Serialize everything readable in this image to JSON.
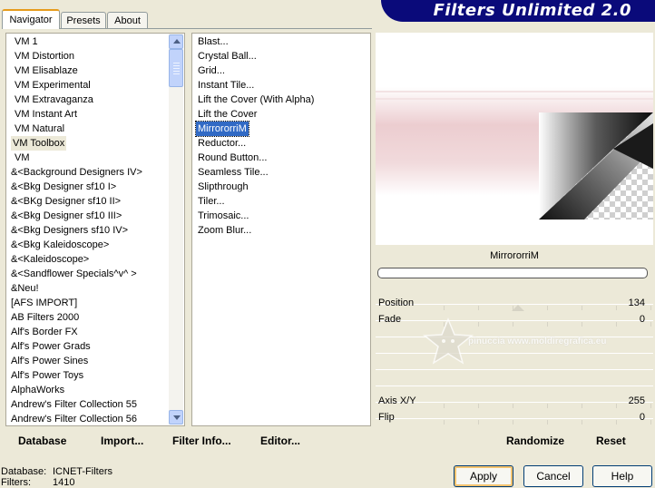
{
  "tabs": [
    {
      "label": "Navigator",
      "active": true
    },
    {
      "label": "Presets",
      "active": false
    },
    {
      "label": "About",
      "active": false
    }
  ],
  "banner": {
    "title": "Filters Unlimited 2.0"
  },
  "categories": [
    "VM 1",
    "VM Distortion",
    "VM Elisablaze",
    "VM Experimental",
    "VM Extravaganza",
    "VM Instant Art",
    "VM Natural",
    "VM Toolbox",
    "VM",
    "&<Background Designers IV>",
    "&<Bkg Designer sf10 I>",
    "&<BKg Designer sf10 II>",
    "&<Bkg Designer sf10 III>",
    "&<Bkg Designers sf10 IV>",
    "&<Bkg Kaleidoscope>",
    "&<Kaleidoscope>",
    "&<Sandflower Specials^v^ >",
    "&Neu!",
    "[AFS IMPORT]",
    "AB Filters 2000",
    "Alf's Border FX",
    "Alf's Power Grads",
    "Alf's Power Sines",
    "Alf's Power Toys",
    "AlphaWorks",
    "Andrew's Filter Collection 55",
    "Andrew's Filter Collection 56"
  ],
  "selected_category": "VM Toolbox",
  "filters": [
    "Blast...",
    "Crystal Ball...",
    "Grid...",
    "Instant Tile...",
    "Lift the Cover (With Alpha)",
    "Lift the Cover",
    "MirrororriM",
    "Reductor...",
    "Round Button...",
    "Seamless Tile...",
    "Slipthrough",
    "Tiler...",
    "Trimosaic...",
    "Zoom Blur..."
  ],
  "selected_filter": "MirrororriM",
  "bottom_links": {
    "database": "Database",
    "import": "Import...",
    "filter_info": "Filter Info...",
    "editor": "Editor..."
  },
  "right_panel": {
    "filter_name": "MirrororriM",
    "sliders": [
      {
        "label": "Position",
        "value": "134"
      },
      {
        "label": "Fade",
        "value": "0"
      },
      {
        "label": "Axis X/Y",
        "value": "255"
      },
      {
        "label": "Flip",
        "value": "0"
      }
    ],
    "randomize": "Randomize",
    "reset": "Reset",
    "watermark": "pinuccia www.moldiregrafica.eu"
  },
  "status": {
    "database_label": "Database:",
    "database_value": "ICNET-Filters",
    "filters_label": "Filters:",
    "filters_value": "1410"
  },
  "buttons": {
    "apply": "Apply",
    "cancel": "Cancel",
    "help": "Help"
  },
  "colors": {
    "banner": "#0a0a7a",
    "selection": "#316ac5",
    "preview_pink": "#eccdd0"
  }
}
